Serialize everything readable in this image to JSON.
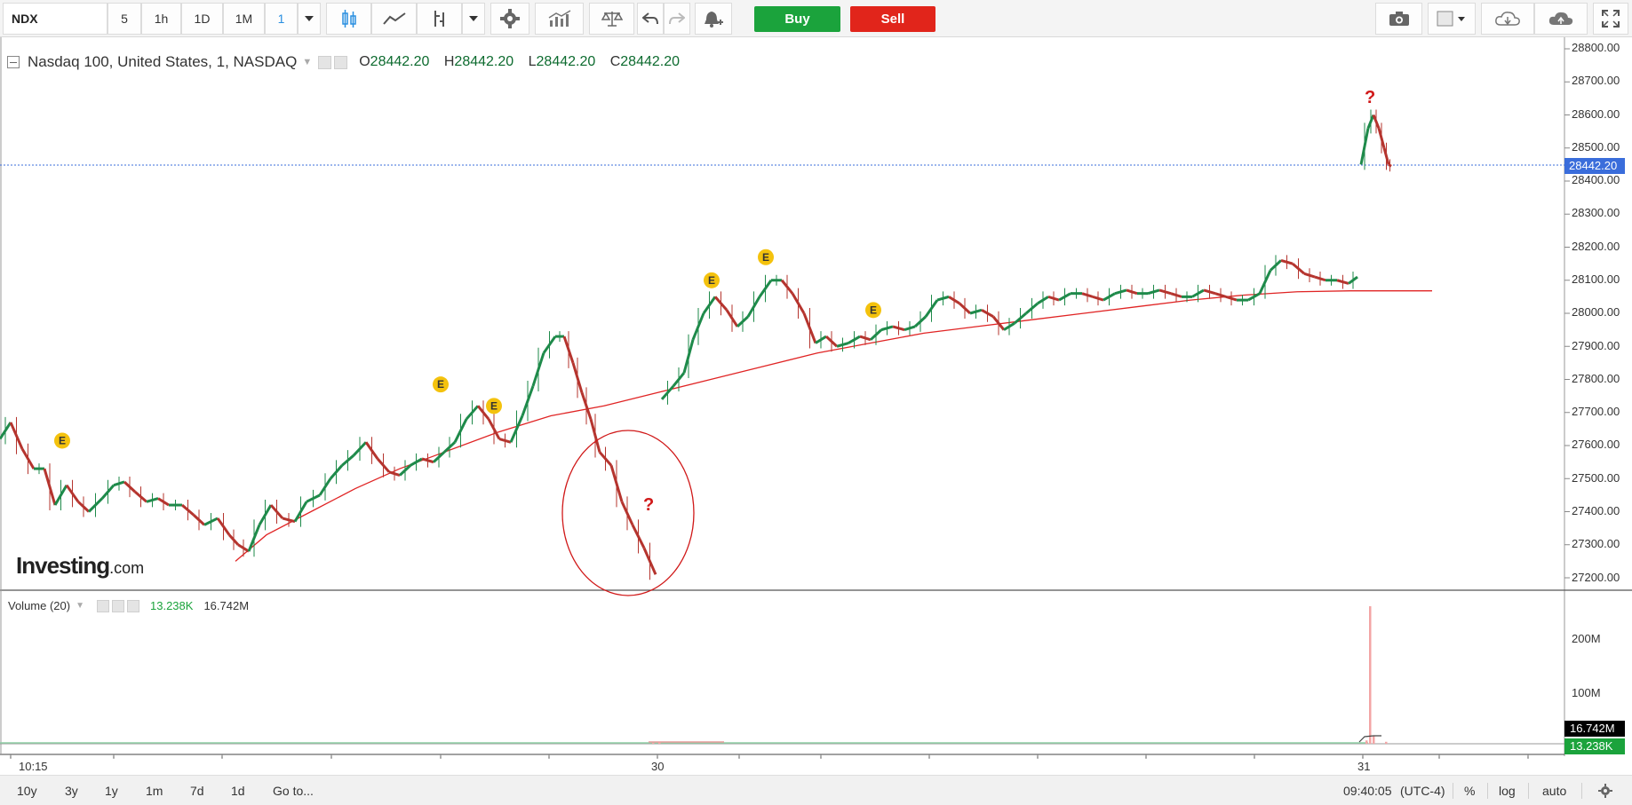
{
  "toolbar": {
    "symbol": "NDX",
    "intervals": [
      "5",
      "1h",
      "1D",
      "1M",
      "1"
    ],
    "active_interval": "1",
    "buy_label": "Buy",
    "sell_label": "Sell"
  },
  "legend": {
    "instrument": "Nasdaq 100, United States, 1, NASDAQ",
    "open_label": "O",
    "open": "28442.20",
    "high_label": "H",
    "high": "28442.20",
    "low_label": "L",
    "low": "28442.20",
    "close_label": "C",
    "close": "28442.20"
  },
  "volume_legend": {
    "title": "Volume (20)",
    "value1": "13.238K",
    "value2": "16.742M"
  },
  "watermark": {
    "brand": "Investing",
    "suffix": ".com"
  },
  "price_scale": {
    "labels": [
      "28800.00",
      "28700.00",
      "28600.00",
      "28500.00",
      "28400.00",
      "28300.00",
      "28200.00",
      "28100.00",
      "28000.00",
      "27900.00",
      "27800.00",
      "27700.00",
      "27600.00",
      "27500.00",
      "27400.00",
      "27300.00",
      "27200.00"
    ],
    "current_price": "28442.20"
  },
  "volume_scale": {
    "labels": [
      "200M",
      "100M"
    ],
    "tag1": "16.742M",
    "tag2": "13.238K"
  },
  "time_axis": {
    "labels": [
      "10:15",
      "30",
      "31"
    ]
  },
  "annotations": {
    "earnings_marker": "E",
    "question_mark": "?"
  },
  "bottom_bar": {
    "ranges": [
      "10y",
      "3y",
      "1y",
      "1m",
      "7d",
      "1d"
    ],
    "goto": "Go to...",
    "clock": "09:40:05",
    "timezone": "(UTC-4)",
    "percent": "%",
    "log": "log",
    "auto": "auto"
  },
  "colors": {
    "up": "#1e8a4a",
    "down": "#b5342e",
    "ma": "#e02424",
    "price_line": "#3a6ddb",
    "buy": "#1ba33c",
    "sell": "#e1251b",
    "earnings": "#f4c20d"
  },
  "chart_data": {
    "type": "line",
    "series": [
      {
        "values": [
          [
            0,
            27620
          ],
          [
            12,
            27670
          ],
          [
            25,
            27590
          ],
          [
            38,
            27530
          ],
          [
            50,
            27530
          ],
          [
            62,
            27420
          ],
          [
            75,
            27480
          ],
          [
            88,
            27430
          ],
          [
            100,
            27400
          ],
          [
            115,
            27440
          ],
          [
            128,
            27480
          ],
          [
            140,
            27490
          ],
          [
            152,
            27460
          ],
          [
            165,
            27430
          ],
          [
            178,
            27440
          ],
          [
            190,
            27420
          ],
          [
            205,
            27420
          ],
          [
            218,
            27390
          ],
          [
            230,
            27360
          ],
          [
            245,
            27380
          ],
          [
            258,
            27330
          ],
          [
            268,
            27300
          ],
          [
            280,
            27280
          ],
          [
            292,
            27360
          ],
          [
            305,
            27420
          ],
          [
            318,
            27380
          ],
          [
            332,
            27370
          ],
          [
            345,
            27430
          ],
          [
            360,
            27450
          ],
          [
            372,
            27500
          ],
          [
            385,
            27540
          ],
          [
            398,
            27570
          ],
          [
            412,
            27610
          ],
          [
            425,
            27560
          ],
          [
            438,
            27520
          ],
          [
            450,
            27510
          ],
          [
            462,
            27540
          ],
          [
            475,
            27560
          ],
          [
            488,
            27550
          ],
          [
            500,
            27580
          ],
          [
            512,
            27610
          ],
          [
            525,
            27680
          ],
          [
            538,
            27720
          ],
          [
            550,
            27680
          ],
          [
            562,
            27620
          ],
          [
            575,
            27610
          ],
          [
            588,
            27690
          ],
          [
            600,
            27780
          ],
          [
            612,
            27880
          ],
          [
            625,
            27930
          ],
          [
            635,
            27930
          ],
          [
            645,
            27850
          ],
          [
            655,
            27760
          ],
          [
            665,
            27680
          ],
          [
            675,
            27580
          ],
          [
            688,
            27540
          ],
          [
            700,
            27430
          ],
          [
            712,
            27360
          ],
          [
            725,
            27290
          ],
          [
            738,
            27210
          ],
          [
            745,
            27740
          ],
          [
            758,
            27780
          ],
          [
            770,
            27820
          ],
          [
            780,
            27920
          ],
          [
            792,
            28000
          ],
          [
            805,
            28050
          ],
          [
            818,
            28010
          ],
          [
            830,
            27960
          ],
          [
            842,
            27990
          ],
          [
            855,
            28050
          ],
          [
            868,
            28100
          ],
          [
            880,
            28100
          ],
          [
            892,
            28060
          ],
          [
            905,
            28000
          ],
          [
            918,
            27910
          ],
          [
            930,
            27930
          ],
          [
            942,
            27900
          ],
          [
            955,
            27910
          ],
          [
            968,
            27930
          ],
          [
            980,
            27920
          ],
          [
            992,
            27950
          ],
          [
            1005,
            27960
          ],
          [
            1018,
            27950
          ],
          [
            1030,
            27960
          ],
          [
            1042,
            27990
          ],
          [
            1055,
            28040
          ],
          [
            1068,
            28050
          ],
          [
            1080,
            28030
          ],
          [
            1092,
            28000
          ],
          [
            1105,
            28010
          ],
          [
            1118,
            27990
          ],
          [
            1130,
            27950
          ],
          [
            1142,
            27970
          ],
          [
            1155,
            28000
          ],
          [
            1168,
            28030
          ],
          [
            1180,
            28050
          ],
          [
            1192,
            28040
          ],
          [
            1205,
            28060
          ],
          [
            1218,
            28060
          ],
          [
            1230,
            28050
          ],
          [
            1242,
            28040
          ],
          [
            1255,
            28060
          ],
          [
            1268,
            28070
          ],
          [
            1280,
            28060
          ],
          [
            1292,
            28060
          ],
          [
            1305,
            28070
          ],
          [
            1318,
            28060
          ],
          [
            1330,
            28050
          ],
          [
            1342,
            28050
          ],
          [
            1355,
            28070
          ],
          [
            1368,
            28060
          ],
          [
            1380,
            28050
          ],
          [
            1392,
            28040
          ],
          [
            1405,
            28040
          ],
          [
            1418,
            28060
          ],
          [
            1430,
            28130
          ],
          [
            1442,
            28160
          ],
          [
            1455,
            28150
          ],
          [
            1468,
            28120
          ],
          [
            1480,
            28110
          ],
          [
            1492,
            28100
          ],
          [
            1505,
            28100
          ],
          [
            1518,
            28090
          ],
          [
            1528,
            28110
          ]
        ]
      },
      {
        "values": [
          [
            265,
            27250
          ],
          [
            300,
            27330
          ],
          [
            350,
            27400
          ],
          [
            400,
            27470
          ],
          [
            450,
            27530
          ],
          [
            500,
            27580
          ],
          [
            560,
            27640
          ],
          [
            620,
            27690
          ],
          [
            680,
            27720
          ],
          [
            740,
            27760
          ],
          [
            800,
            27800
          ],
          [
            860,
            27840
          ],
          [
            920,
            27880
          ],
          [
            980,
            27910
          ],
          [
            1040,
            27940
          ],
          [
            1100,
            27960
          ],
          [
            1160,
            27980
          ],
          [
            1220,
            28000
          ],
          [
            1280,
            28020
          ],
          [
            1340,
            28040
          ],
          [
            1400,
            28055
          ],
          [
            1460,
            28065
          ],
          [
            1520,
            28068
          ],
          [
            1580,
            28068
          ],
          [
            1612,
            28068
          ]
        ]
      },
      {
        "values": [
          [
            1532,
            28450
          ],
          [
            1540,
            28560
          ],
          [
            1546,
            28600
          ],
          [
            1552,
            28560
          ],
          [
            1558,
            28500
          ],
          [
            1563,
            28450
          ],
          [
            1566,
            28445
          ]
        ]
      }
    ],
    "volume": [
      [
        735,
        1.4
      ],
      [
        742,
        2.0
      ],
      [
        1538,
        5
      ],
      [
        1542,
        208
      ],
      [
        1546,
        12
      ],
      [
        1560,
        3
      ]
    ],
    "earnings_marker_positions": [
      [
        70,
        27545
      ],
      [
        496,
        27715
      ],
      [
        556,
        27650
      ],
      [
        801,
        28030
      ],
      [
        862,
        28100
      ],
      [
        983,
        27940
      ]
    ],
    "ylim": [
      27200,
      28800
    ],
    "volume_ylim": [
      0,
      200
    ]
  }
}
